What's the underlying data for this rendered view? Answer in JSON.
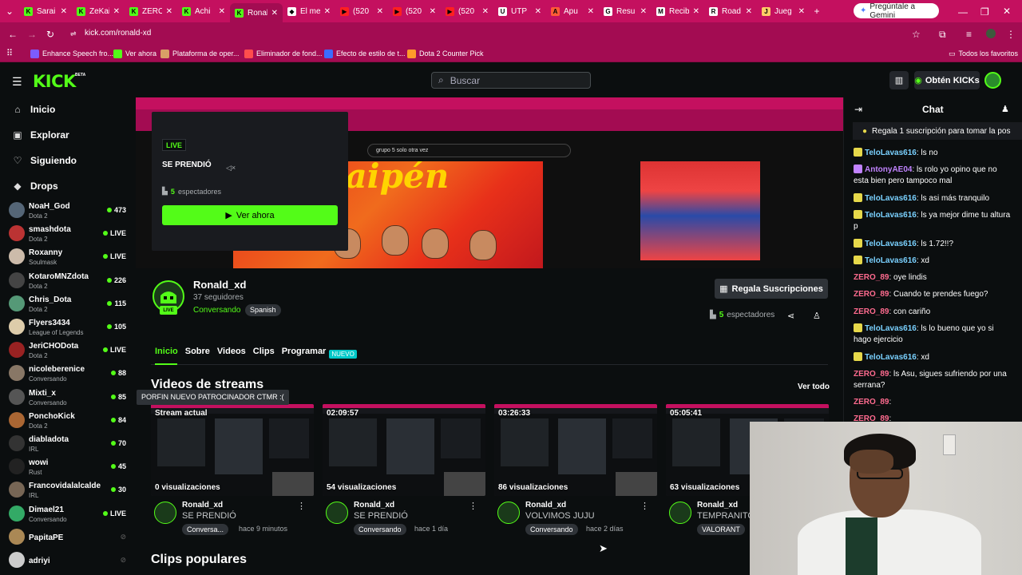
{
  "browser": {
    "tabs": [
      {
        "label": "Sarai",
        "color": "#53fc18",
        "icon": "K"
      },
      {
        "label": "ZeKai",
        "color": "#53fc18",
        "icon": "K"
      },
      {
        "label": "ZERO",
        "color": "#53fc18",
        "icon": "K"
      },
      {
        "label": "Achi",
        "color": "#53fc18",
        "icon": "K"
      },
      {
        "label": "Ronal",
        "color": "#53fc18",
        "icon": "K",
        "active": true
      },
      {
        "label": "El me",
        "color": "#ffffff",
        "icon": "◆"
      },
      {
        "label": "(520",
        "color": "#ff2020",
        "icon": "▶"
      },
      {
        "label": "(520",
        "color": "#ff2020",
        "icon": "▶"
      },
      {
        "label": "(520",
        "color": "#ff2020",
        "icon": "▶"
      },
      {
        "label": "UTP",
        "color": "#ffffff",
        "icon": "U"
      },
      {
        "label": "Apu",
        "color": "#ff5a36",
        "icon": "A"
      },
      {
        "label": "Resu",
        "color": "#ffffff",
        "icon": "G"
      },
      {
        "label": "Recib",
        "color": "#ffffff",
        "icon": "M"
      },
      {
        "label": "Road",
        "color": "#ffffff",
        "icon": "R"
      },
      {
        "label": "Jueg",
        "color": "#ffcc66",
        "icon": "J"
      }
    ],
    "gemini_label": "Pregúntale a Gemini",
    "url": "kick.com/ronald-xd",
    "bookmarks": [
      {
        "label": "Enhance Speech fro...",
        "color": "#7c5cff"
      },
      {
        "label": "Ver ahora",
        "color": "#53fc18"
      },
      {
        "label": "Plataforma de oper...",
        "color": "#d9a066"
      },
      {
        "label": "Eliminador de fond...",
        "color": "#ff4d4d"
      },
      {
        "label": "Efecto de estilo de t...",
        "color": "#3b6cff"
      },
      {
        "label": "Dota 2 Counter Pick",
        "color": "#ff9a2a"
      }
    ],
    "all_favorites": "Todos los favoritos"
  },
  "header": {
    "logo": "KICK",
    "beta": "BETA",
    "search_placeholder": "Buscar",
    "kicks_label": "Obtén KICKs"
  },
  "nav": [
    {
      "label": "Inicio",
      "icon": "⌂"
    },
    {
      "label": "Explorar",
      "icon": "▣"
    },
    {
      "label": "Siguiendo",
      "icon": "♡"
    },
    {
      "label": "Drops",
      "icon": "◆"
    }
  ],
  "channels": [
    {
      "name": "NoaH_God",
      "cat": "Dota 2",
      "val": "473",
      "color": "#556677"
    },
    {
      "name": "smashdota",
      "cat": "Dota 2",
      "val": "LIVE",
      "color": "#b33"
    },
    {
      "name": "Roxanny",
      "cat": "Soulmask",
      "val": "LIVE",
      "color": "#cba"
    },
    {
      "name": "KotaroMNZdota",
      "cat": "Dota 2",
      "val": "226",
      "color": "#444"
    },
    {
      "name": "Chris_Dota",
      "cat": "Dota 2",
      "val": "115",
      "color": "#597"
    },
    {
      "name": "Flyers3434",
      "cat": "League of Legends",
      "val": "105",
      "color": "#dca"
    },
    {
      "name": "JeriCHODota",
      "cat": "Dota 2",
      "val": "LIVE",
      "color": "#922"
    },
    {
      "name": "nicoleberenice",
      "cat": "Conversando",
      "val": "88",
      "color": "#876"
    },
    {
      "name": "Mixti_x",
      "cat": "Conversando",
      "val": "85",
      "color": "#555"
    },
    {
      "name": "PonchoKick",
      "cat": "Dota 2",
      "val": "84",
      "color": "#a63"
    },
    {
      "name": "diabladota",
      "cat": "IRL",
      "val": "70",
      "color": "#333"
    },
    {
      "name": "wowi",
      "cat": "Rust",
      "val": "45",
      "color": "#222"
    },
    {
      "name": "Francovidalalcalde",
      "cat": "IRL",
      "val": "30",
      "color": "#765"
    },
    {
      "name": "Dimael21",
      "cat": "Conversando",
      "val": "LIVE",
      "color": "#3a6"
    },
    {
      "name": "PapitaPE",
      "cat": "",
      "val": "",
      "color": "#a85"
    },
    {
      "name": "adriyi",
      "cat": "",
      "val": "",
      "color": "#ccc"
    }
  ],
  "player": {
    "live": "LIVE",
    "title": "SE PRENDIÓ",
    "viewers_num": "5",
    "viewers_label": "espectadores",
    "watch_now": "Ver ahora",
    "inner_search": "grupo 5 solo otra vez"
  },
  "channel": {
    "name": "Ronald_xd",
    "followers": "37 seguidores",
    "category": "Conversando",
    "language": "Spanish",
    "live_pill": "LIVE",
    "subs_button": "Regala Suscripciones",
    "viewers_num": "5",
    "viewers_label": "espectadores"
  },
  "tabs": [
    {
      "label": "Inicio",
      "active": true
    },
    {
      "label": "Sobre"
    },
    {
      "label": "Videos"
    },
    {
      "label": "Clips"
    },
    {
      "label": "Programar"
    }
  ],
  "new_badge": "NUEVO",
  "videos_section": "Videos de streams",
  "see_all": "Ver todo",
  "tooltip": "PORFIN NUEVO PATROCINADOR CTMR :(",
  "videos": [
    {
      "duration": "Stream actual",
      "views": "0 visualizaciones",
      "author": "Ronald_xd",
      "title": "SE PRENDIÓ",
      "cat": "Conversa...",
      "date": "hace 9 minutos"
    },
    {
      "duration": "02:09:57",
      "views": "54 visualizaciones",
      "author": "Ronald_xd",
      "title": "SE PRENDIÓ",
      "cat": "Conversando",
      "date": "hace 1 día"
    },
    {
      "duration": "03:26:33",
      "views": "86 visualizaciones",
      "author": "Ronald_xd",
      "title": "VOLVIMOS JUJU",
      "cat": "Conversando",
      "date": "hace 2 días"
    },
    {
      "duration": "05:05:41",
      "views": "63 visualizaciones",
      "author": "Ronald_xd",
      "title": "TEMPRANITO",
      "cat": "VALORANT",
      "date": ""
    }
  ],
  "clips_section": "Clips populares",
  "chat": {
    "title": "Chat",
    "pinned": "Regala 1 suscripción para tomar la pos",
    "messages": [
      {
        "user": "TeloLavas616",
        "text": "ls no",
        "cls": "u1",
        "badge": "#e6d84a"
      },
      {
        "user": "AntonyAE04",
        "text": "ls rolo yo opino que no esta bien pero tampoco mal",
        "cls": "u3",
        "badge": "#c183ff"
      },
      {
        "user": "TeloLavas616",
        "text": "ls asi más tranquilo",
        "cls": "u1",
        "badge": "#e6d84a"
      },
      {
        "user": "TeloLavas616",
        "text": "ls ya mejor dime tu altura p",
        "cls": "u1",
        "badge": "#e6d84a"
      },
      {
        "user": "TeloLavas616",
        "text": "ls 1.72!!?",
        "cls": "u1",
        "badge": "#e6d84a"
      },
      {
        "user": "TeloLavas616",
        "text": "xd",
        "cls": "u1",
        "badge": "#e6d84a"
      },
      {
        "user": "ZERO_89",
        "text": "oye lindis",
        "cls": "u2",
        "badge": ""
      },
      {
        "user": "ZERO_89",
        "text": "Cuando te prendes fuego?",
        "cls": "u2",
        "badge": ""
      },
      {
        "user": "ZERO_89",
        "text": "con cariño",
        "cls": "u2",
        "badge": ""
      },
      {
        "user": "TeloLavas616",
        "text": "ls lo bueno que yo si hago ejercicio",
        "cls": "u1",
        "badge": "#e6d84a"
      },
      {
        "user": "TeloLavas616",
        "text": "xd",
        "cls": "u1",
        "badge": "#e6d84a"
      },
      {
        "user": "ZERO_89",
        "text": "ls Asu, sigues sufriendo por una serrana?",
        "cls": "u2",
        "badge": ""
      },
      {
        "user": "ZERO_89",
        "text": "",
        "cls": "u2",
        "badge": ""
      },
      {
        "user": "ZERO_89",
        "text": "",
        "cls": "u2",
        "badge": ""
      }
    ]
  }
}
